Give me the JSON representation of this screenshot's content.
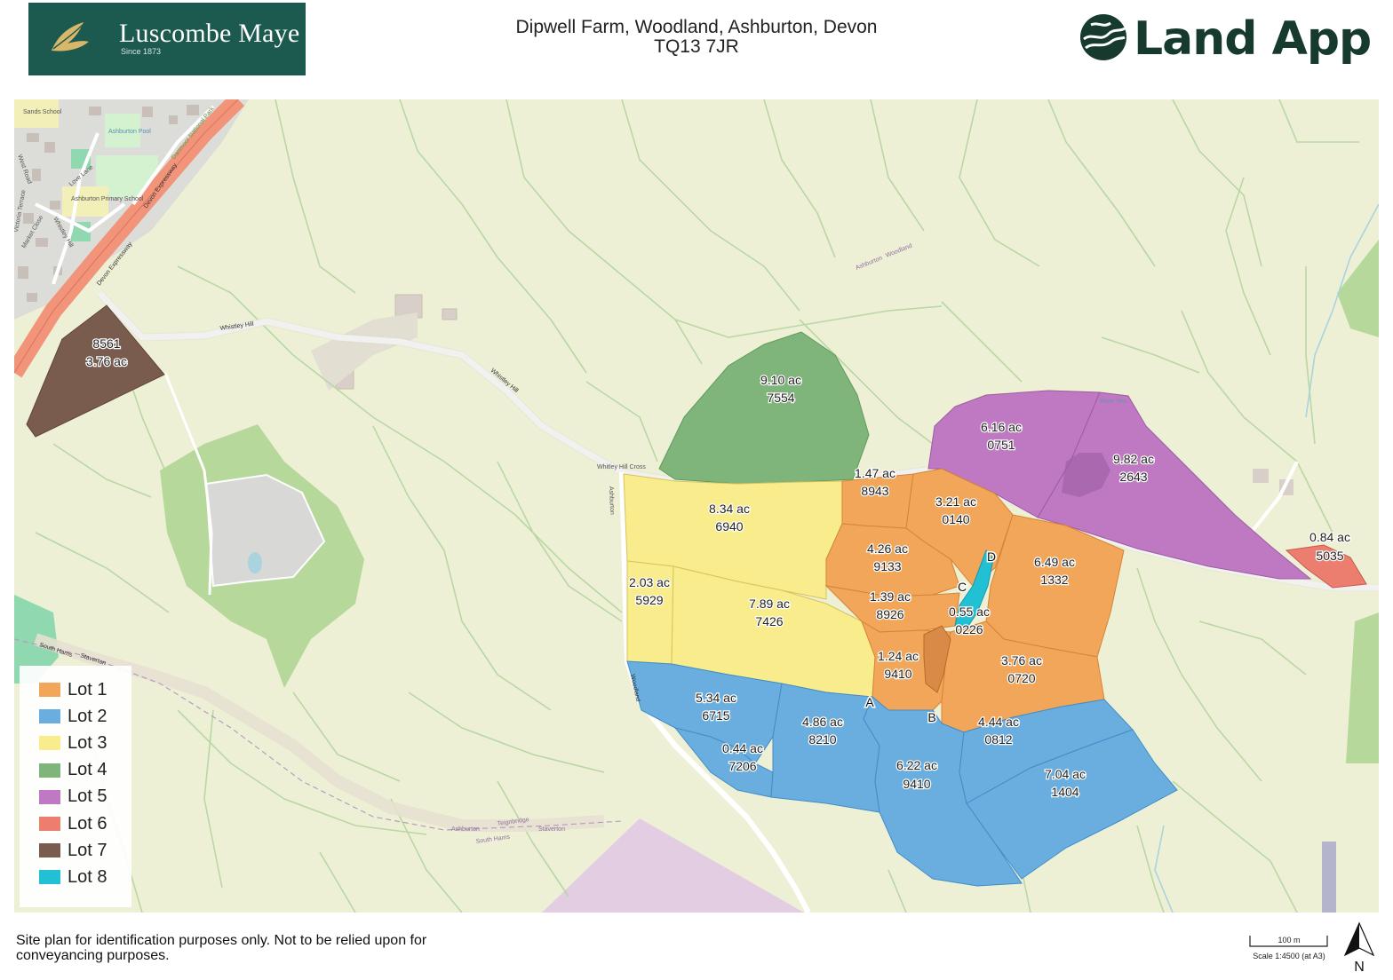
{
  "header": {
    "brand_left": "Luscombe Maye",
    "since": "Since 1873",
    "title_line1": "Dipwell Farm, Woodland, Ashburton, Devon",
    "title_line2": "TQ13 7JR",
    "brand_right": "Land App"
  },
  "colors": {
    "lot1": "#f2a65a",
    "lot2": "#6aaedf",
    "lot3": "#f8ec8c",
    "lot4": "#7fb57a",
    "lot5": "#bf78c2",
    "lot6": "#ec7e70",
    "lot7": "#7a5c4e",
    "lot8": "#22c0d4",
    "base_fields": "#eef0d6",
    "field_lines": "#b9d7a4",
    "road_main": "#f2947a",
    "road_minor": "#ffffff"
  },
  "legend": [
    {
      "label": "Lot 1",
      "color": "#f2a65a"
    },
    {
      "label": "Lot 2",
      "color": "#6aaedf"
    },
    {
      "label": "Lot 3",
      "color": "#f8ec8c"
    },
    {
      "label": "Lot 4",
      "color": "#7fb57a"
    },
    {
      "label": "Lot 5",
      "color": "#bf78c2"
    },
    {
      "label": "Lot 6",
      "color": "#ec7e70"
    },
    {
      "label": "Lot 7",
      "color": "#7a5c4e"
    },
    {
      "label": "Lot 8",
      "color": "#22c0d4"
    }
  ],
  "parcels": {
    "p8561": {
      "l1": "8561",
      "l2": "3.76 ac"
    },
    "p7554": {
      "l1": "9.10 ac",
      "l2": "7554"
    },
    "p8943": {
      "l1": "1.47 ac",
      "l2": "8943"
    },
    "p0751": {
      "l1": "6.16 ac",
      "l2": "0751"
    },
    "p2643": {
      "l1": "9.82 ac",
      "l2": "2643"
    },
    "p0140": {
      "l1": "3.21 ac",
      "l2": "0140"
    },
    "p6940": {
      "l1": "8.34 ac",
      "l2": "6940"
    },
    "p9133": {
      "l1": "4.26 ac",
      "l2": "9133"
    },
    "p1332": {
      "l1": "6.49 ac",
      "l2": "1332"
    },
    "p5035": {
      "l1": "0.84 ac",
      "l2": "5035"
    },
    "p5929": {
      "l1": "2.03 ac",
      "l2": "5929"
    },
    "p7426": {
      "l1": "7.89 ac",
      "l2": "7426"
    },
    "p8926": {
      "l1": "1.39 ac",
      "l2": "8926"
    },
    "p0226": {
      "l1": "0.55 ac",
      "l2": "0226"
    },
    "p9410a": {
      "l1": "1.24 ac",
      "l2": "9410"
    },
    "p0720": {
      "l1": "3.76 ac",
      "l2": "0720"
    },
    "p6715": {
      "l1": "5.34 ac",
      "l2": "6715"
    },
    "p8210": {
      "l1": "4.86 ac",
      "l2": "8210"
    },
    "p0812": {
      "l1": "4.44 ac",
      "l2": "0812"
    },
    "p7206": {
      "l1": "0.44 ac",
      "l2": "7206"
    },
    "p9410b": {
      "l1": "6.22 ac",
      "l2": "9410"
    },
    "p1404": {
      "l1": "7.04 ac",
      "l2": "1404"
    }
  },
  "points": {
    "a": "A",
    "b": "B",
    "c": "C",
    "d": "D"
  },
  "map_labels": {
    "sands_school": "Sands School",
    "ashburton_pool": "Ashburton Pool",
    "primary_school": "Ashburton Primary School",
    "love_lane": "Love Lane",
    "whistley_hill_small": "Whistley Hill",
    "devon_expressway_1": "Devon Expressway",
    "devon_expressway_2": "Devon Expressway",
    "dartmoor_np": "Dartmoor National Park",
    "whistley_hill_1": "Whistley Hill",
    "whistley_hill_2": "Whistley Hill",
    "whitley_hill_cross": "Whitley Hill Cross",
    "ashburton_road": "Ashburton",
    "ashburton_woodland_1": "Ashburton",
    "ashburton_woodland_2": "Woodland",
    "river_yeo": "River Yeo",
    "woodland_road": "Woodland",
    "south_hams": "South Hams",
    "staverton": "Staverton",
    "ash_teign_1": "Ashburton",
    "ash_teign_2": "Teignbridge",
    "south_hams_2": "South Hams",
    "staverton_2": "Staverton",
    "market_close": "Market Close",
    "vian_terrace": "Victoria Terrace",
    "west_road": "West Road"
  },
  "footer": {
    "disclaimer": "Site plan for identification purposes only. Not to be relied upon for conveyancing purposes.",
    "scale_distance": "100 m",
    "scale_text": "Scale 1:4500 (at A3)",
    "north": "N"
  }
}
